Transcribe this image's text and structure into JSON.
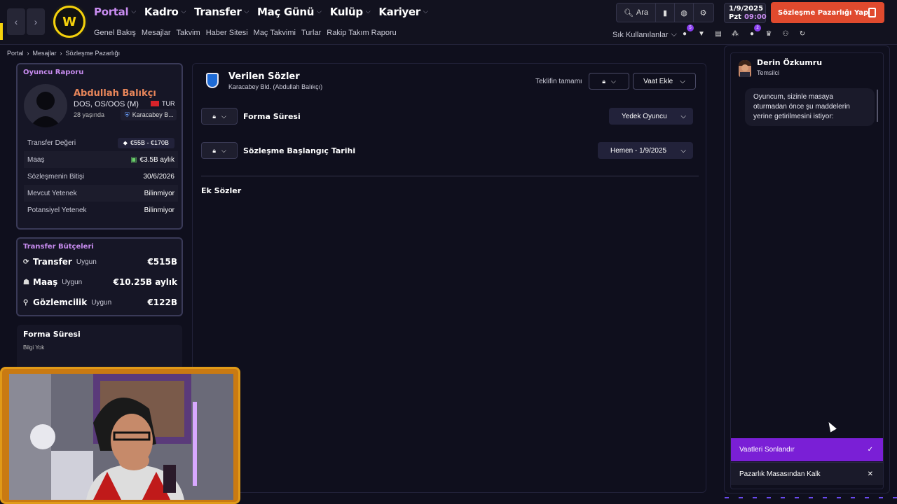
{
  "header": {
    "menu": [
      {
        "label": "Portal",
        "active": true
      },
      {
        "label": "Kadro",
        "active": false
      },
      {
        "label": "Transfer",
        "active": false
      },
      {
        "label": "Maç Günü",
        "active": false
      },
      {
        "label": "Kulüp",
        "active": false
      },
      {
        "label": "Kariyer",
        "active": false
      }
    ],
    "submenu": [
      "Genel Bakış",
      "Mesajlar",
      "Takvim",
      "Haber Sitesi",
      "Maç Takvimi",
      "Turlar",
      "Rakip Takım Raporu"
    ],
    "search_label": "Ara",
    "date_line1": "1/9/2025",
    "date_day": "Pzt",
    "date_time": "09:00",
    "cta_label": "Sözleşme Pazarlığı Yap",
    "favorites_label": "Sık Kullanılanlar",
    "badge_a": "5",
    "badge_b": "2",
    "accent_color": "#c88cf0",
    "cta_color": "#e04a2e"
  },
  "breadcrumb": [
    "Portal",
    "Mesajlar",
    "Sözleşme Pazarlığı"
  ],
  "player_report": {
    "title": "Oyuncu Raporu",
    "name": "Abdullah Balıkçı",
    "position": "DOS, OS/OOS (M)",
    "nationality": "TUR",
    "age": "28 yaşında",
    "club": "Karacabey B...",
    "stats": [
      {
        "label": "Transfer Değeri",
        "value": "€55B - €170B"
      },
      {
        "label": "Maaş",
        "value": "€3.5B aylık"
      },
      {
        "label": "Sözleşmenin Bitişi",
        "value": "30/6/2026"
      },
      {
        "label": "Mevcut Yetenek",
        "value": "Bilinmiyor"
      },
      {
        "label": "Potansiyel Yetenek",
        "value": "Bilinmiyor"
      }
    ]
  },
  "budgets": {
    "title": "Transfer Bütçeleri",
    "rows": [
      {
        "label": "Transfer",
        "status": "Uygun",
        "amount": "€515B"
      },
      {
        "label": "Maaş",
        "status": "Uygun",
        "amount": "€10.25B aylık"
      },
      {
        "label": "Gözlemcilik",
        "status": "Uygun",
        "amount": "€122B"
      }
    ]
  },
  "contract_card": {
    "title": "Forma Süresi",
    "subtitle": "Bilgi Yok"
  },
  "promises": {
    "title": "Verilen Sözler",
    "subtitle": "Karacabey Bld. (Abdullah Balıkçı)",
    "offer_label": "Teklifin tamamı",
    "add_label": "Vaat Ekle",
    "rows": [
      {
        "label": "Forma Süresi",
        "value": "Yedek Oyuncu"
      },
      {
        "label": "Sözleşme Başlangıç Tarihi",
        "value": "Hemen - 1/9/2025"
      }
    ],
    "extra_label": "Ek Sözler"
  },
  "chat": {
    "agent_name": "Derin Özkumru",
    "agent_role": "Temsilci",
    "message": "Oyuncum, sizinle masaya oturmadan önce şu maddelerin yerine getirilmesini istiyor:",
    "options": [
      {
        "label": "Vaatleri Sonlandır",
        "icon": "check-icon"
      },
      {
        "label": "Pazarlık Masasından Kalk",
        "icon": "close-icon"
      }
    ],
    "primary_color": "#7a1fd6"
  }
}
